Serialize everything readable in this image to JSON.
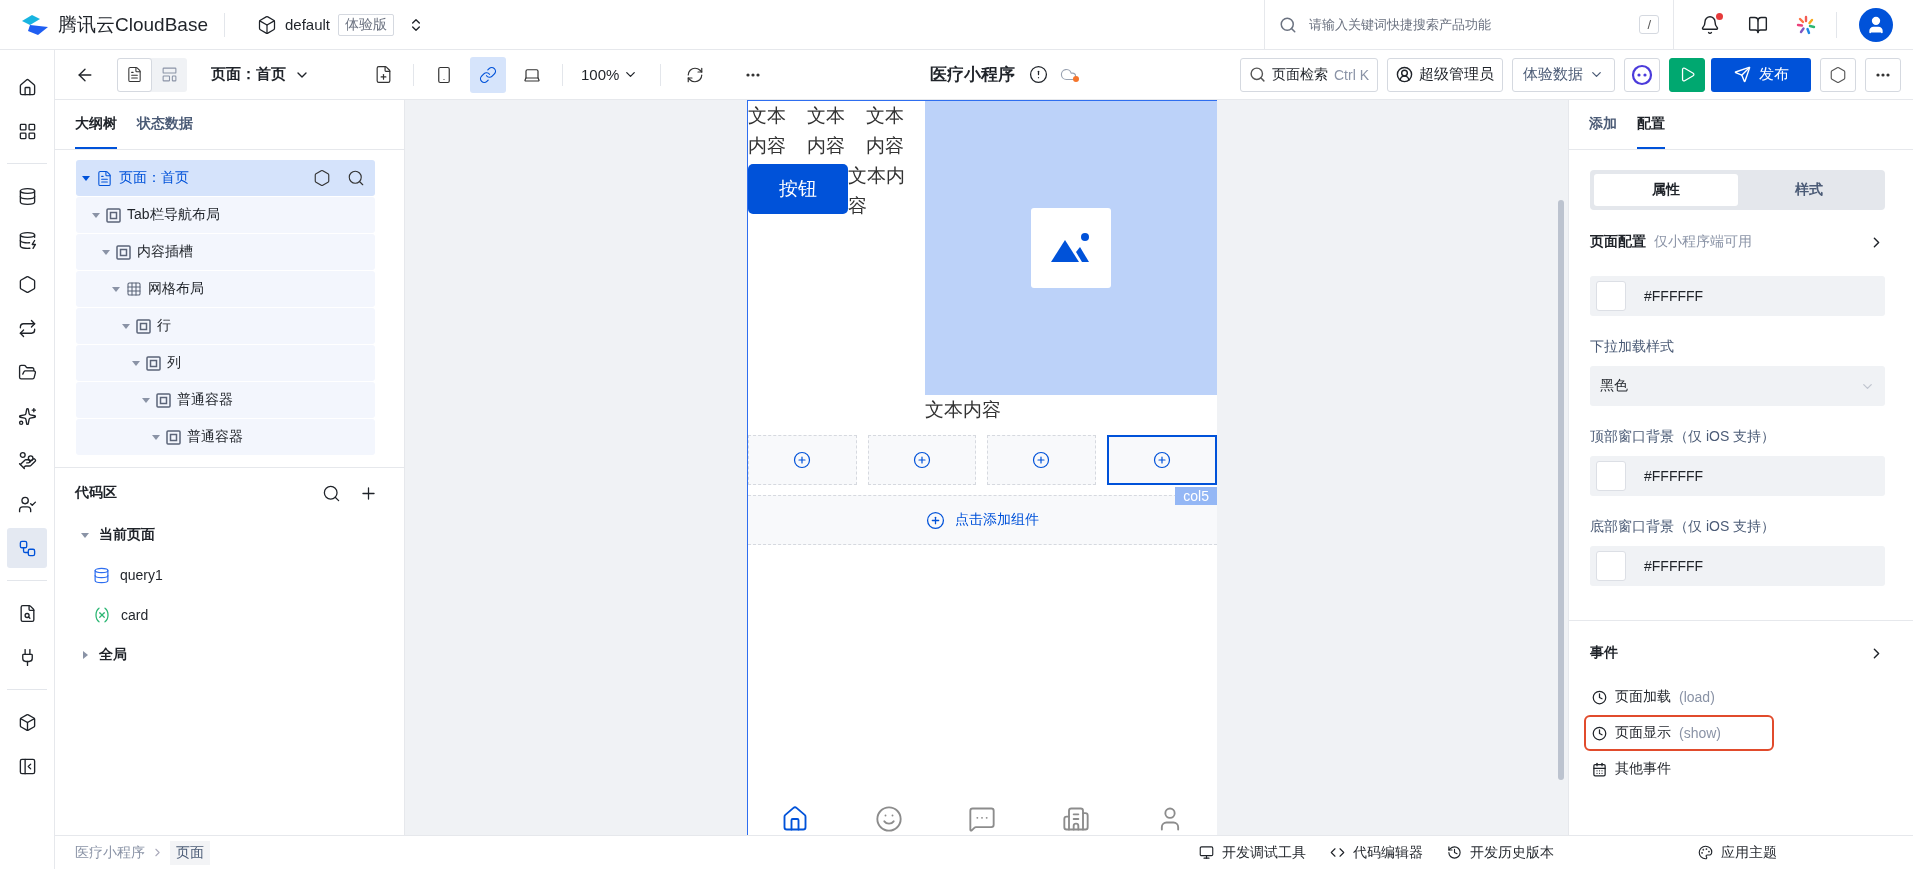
{
  "header": {
    "brand": "腾讯云CloudBase",
    "environment": "default",
    "edition_badge": "体验版",
    "search": {
      "placeholder": "请输入关键词快捷搜索产品功能",
      "shortcut": "/"
    }
  },
  "rail": {
    "groups": [
      [
        {
          "kind": "home",
          "selected": false
        },
        {
          "kind": "apps",
          "selected": false
        }
      ],
      [
        {
          "kind": "database",
          "selected": false
        },
        {
          "kind": "data-model",
          "selected": false
        },
        {
          "kind": "api",
          "selected": false
        },
        {
          "kind": "workflow",
          "selected": false
        },
        {
          "kind": "storage",
          "selected": false
        },
        {
          "kind": "ai",
          "selected": false
        },
        {
          "kind": "payment",
          "selected": false
        },
        {
          "kind": "users",
          "selected": false
        },
        {
          "kind": "lowcode",
          "selected": true
        }
      ],
      [
        {
          "kind": "logs",
          "selected": false
        },
        {
          "kind": "plugin",
          "selected": false
        }
      ],
      [
        {
          "kind": "extensions",
          "selected": false
        },
        {
          "kind": "collapse",
          "selected": false
        }
      ]
    ]
  },
  "toolbar": {
    "view_modes": [
      {
        "kind": "page",
        "selected": true
      },
      {
        "kind": "layout",
        "selected": false
      }
    ],
    "page_selector": "页面：首页",
    "devices": [
      {
        "kind": "mobile",
        "selected": false
      },
      {
        "kind": "miniprogram",
        "selected": true
      },
      {
        "kind": "desktop",
        "selected": false
      }
    ],
    "zoom": "100%",
    "app_title": "医疗小程序",
    "page_search": {
      "label": "页面检索",
      "shortcut": "Ctrl K"
    },
    "role": "超级管理员",
    "data_mode": "体验数据",
    "publish": "发布"
  },
  "left_panel": {
    "tabs": [
      {
        "label": "大纲树",
        "selected": true
      },
      {
        "label": "状态数据",
        "selected": false
      }
    ],
    "outline": [
      {
        "label": "页面：首页",
        "kind": "page",
        "selected": true,
        "expanded": true,
        "children": [
          {
            "label": "Tab栏导航布局",
            "kind": "container",
            "selected": false,
            "expanded": true,
            "children": [
              {
                "label": "内容插槽",
                "kind": "container",
                "selected": false,
                "expanded": true,
                "children": [
                  {
                    "label": "网格布局",
                    "kind": "grid",
                    "selected": false,
                    "expanded": true,
                    "children": [
                      {
                        "label": "行",
                        "kind": "container",
                        "selected": false,
                        "expanded": true,
                        "children": [
                          {
                            "label": "列",
                            "kind": "container",
                            "selected": false,
                            "expanded": true,
                            "children": [
                              {
                                "label": "普通容器",
                                "kind": "container",
                                "selected": false,
                                "expanded": true,
                                "children": [
                                  {
                                    "label": "普通容器",
                                    "kind": "container",
                                    "selected": false,
                                    "expanded": true
                                  }
                                ]
                              }
                            ]
                          }
                        ]
                      }
                    ]
                  }
                ]
              }
            ]
          }
        ]
      }
    ],
    "code_area": {
      "title": "代码区",
      "groups": [
        {
          "label": "当前页面",
          "expanded": true,
          "items": [
            {
              "kind": "query",
              "label": "query1"
            },
            {
              "kind": "variable",
              "label": "card"
            }
          ]
        },
        {
          "label": "全局",
          "expanded": false
        }
      ]
    }
  },
  "canvas": {
    "grid_texts": [
      "文本内容",
      "文本内容",
      "文本内容"
    ],
    "button": "按钮",
    "button_text": "文本内容",
    "caption": "文本内容",
    "slots": [
      {
        "selected": false
      },
      {
        "selected": false
      },
      {
        "selected": false
      },
      {
        "selected": true,
        "badge": "col5"
      }
    ],
    "add_component": "点击添加组件",
    "tab_bar": [
      {
        "kind": "home",
        "selected": true
      },
      {
        "kind": "smile",
        "selected": false
      },
      {
        "kind": "chat",
        "selected": false
      },
      {
        "kind": "building",
        "selected": false
      },
      {
        "kind": "user",
        "selected": false
      }
    ]
  },
  "right_panel": {
    "tabs": [
      {
        "label": "添加",
        "selected": false
      },
      {
        "label": "配置",
        "selected": true
      }
    ],
    "segments": [
      {
        "label": "属性",
        "selected": true
      },
      {
        "label": "样式",
        "selected": false
      }
    ],
    "page_config": {
      "title": "页面配置",
      "note": "仅小程序端可用"
    },
    "fields": [
      {
        "kind": "color",
        "value": "#FFFFFF"
      },
      {
        "kind": "select",
        "label": "下拉加载样式",
        "value": "黑色"
      },
      {
        "kind": "color",
        "label": "顶部窗口背景（仅 iOS 支持）",
        "value": "#FFFFFF"
      },
      {
        "kind": "color",
        "label": "底部窗口背景（仅 iOS 支持）",
        "value": "#FFFFFF"
      }
    ],
    "events": {
      "title": "事件",
      "items": [
        {
          "kind": "clock",
          "name": "页面加载",
          "code": "(load)",
          "highlighted": false
        },
        {
          "kind": "clock",
          "name": "页面显示",
          "code": "(show)",
          "highlighted": true
        },
        {
          "kind": "calendar",
          "name": "其他事件",
          "highlighted": false
        }
      ]
    }
  },
  "status_bar": {
    "breadcrumb": [
      "医疗小程序",
      "页面"
    ],
    "tools": [
      {
        "kind": "debug",
        "label": "开发调试工具"
      },
      {
        "kind": "code",
        "label": "代码编辑器"
      },
      {
        "kind": "history",
        "label": "开发历史版本"
      },
      {
        "kind": "theme",
        "label": "应用主题"
      }
    ]
  }
}
